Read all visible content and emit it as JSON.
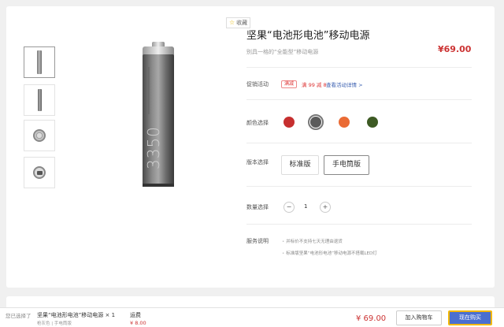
{
  "product": {
    "favorite_label": "收藏",
    "title": "坚果“电池形电池”移动电源",
    "subtitle": "别具一格的“全能型”移动电源",
    "price": "¥69.00",
    "battery_print": "3350"
  },
  "promo": {
    "label": "促销活动",
    "tag": "满减",
    "text": "满 99 减 8",
    "link": "查看活动详情 >"
  },
  "color": {
    "label": "颜色选择",
    "swatches": [
      {
        "name": "red",
        "hex": "#c62f2f"
      },
      {
        "name": "gray",
        "hex": "#5a5a5a",
        "selected": true
      },
      {
        "name": "orange",
        "hex": "#ea6b35"
      },
      {
        "name": "green",
        "hex": "#3d5a24"
      }
    ]
  },
  "version": {
    "label": "版本选择",
    "options": [
      "标准版",
      "手电筒版"
    ],
    "selected_index": 1
  },
  "quantity": {
    "label": "数量选择",
    "minus": "−",
    "value": "1",
    "plus": "+"
  },
  "service": {
    "label": "服务说明",
    "items": [
      "并标价不支持七天无理由退货",
      "标准版坚果“电池形电池”移动电源不搭载LED灯"
    ]
  },
  "bottom_bar": {
    "selected_label": "您已选择了",
    "product_name": "坚果“电池形电池”移动电源 × 1",
    "spec": "枪灰色 | 手电筒版",
    "shipping_label": "运费",
    "shipping_price": "¥ 8.00",
    "total": "¥ 69.00",
    "add_to_cart": "加入购物车",
    "buy_now": "现在购买"
  },
  "colors": {
    "price_red": "#cc3333",
    "buy_button": "#4a6fd0",
    "buy_border": "#f2b705"
  }
}
